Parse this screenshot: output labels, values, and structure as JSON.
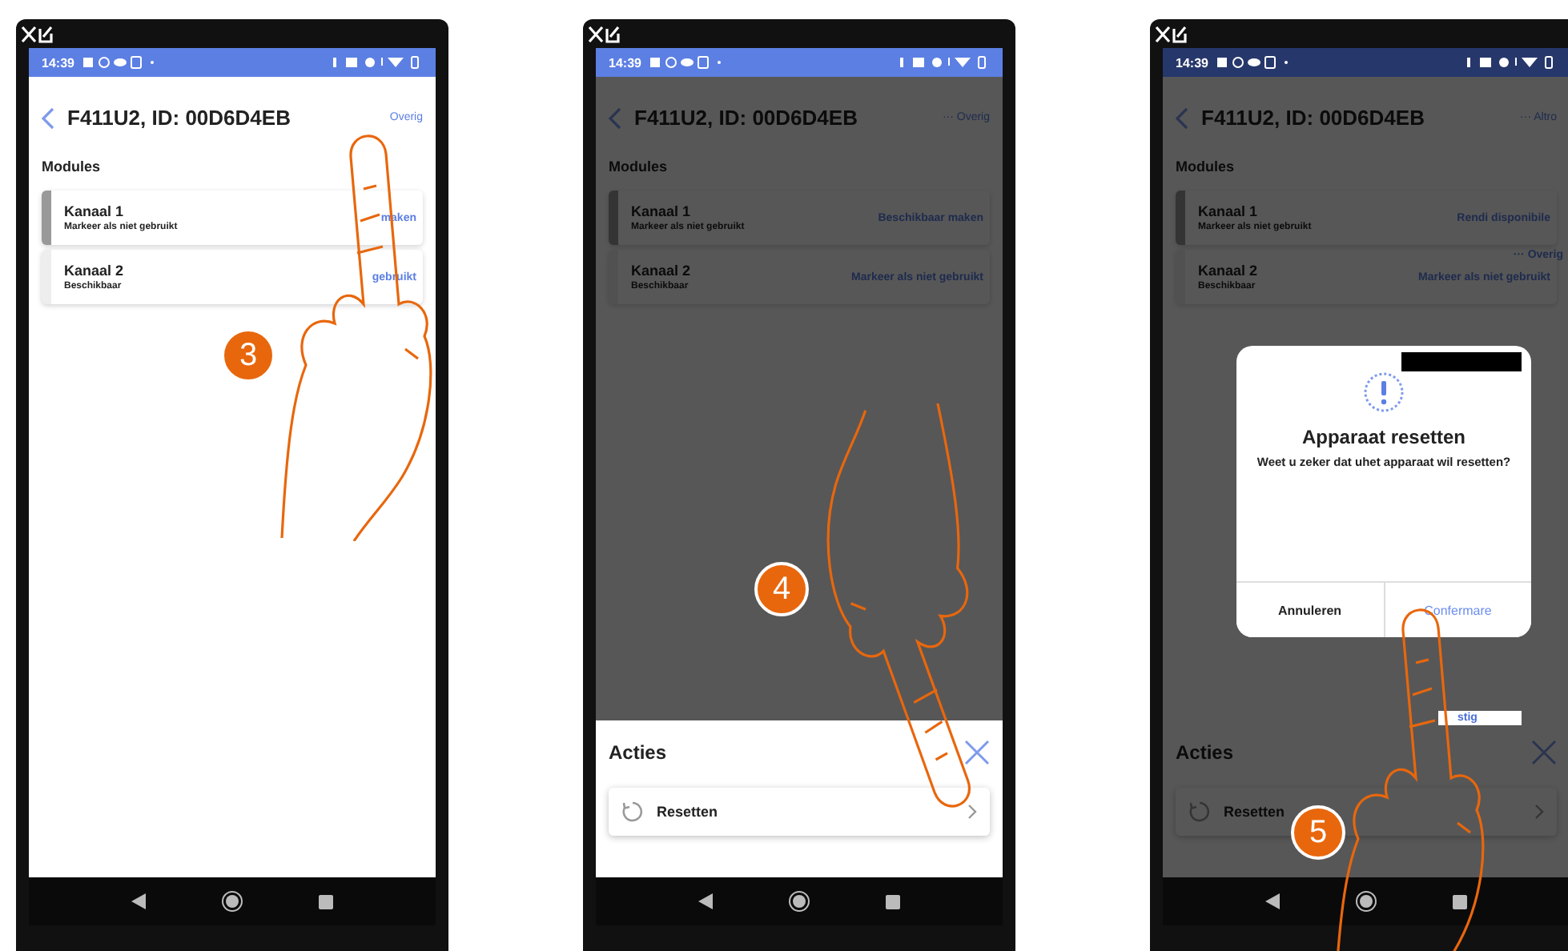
{
  "phones": [
    {
      "step": "3",
      "dimmed": false,
      "time": "14:39",
      "title": "F411U2, ID: 00D6D4EB",
      "header_action": "Overig",
      "section": "Modules",
      "cards": [
        {
          "title": "Kanaal 1",
          "subtitle": "Markeer als niet gebruikt",
          "action": "maken",
          "selected": true
        },
        {
          "title": "Kanaal 2",
          "subtitle": "Beschikbaar",
          "action": "gebruikt",
          "selected": false
        }
      ],
      "hand_pointing_down": false
    },
    {
      "step": "4",
      "dimmed": true,
      "time": "14:39",
      "title": "F411U2, ID: 00D6D4EB",
      "header_action": "··· Overig",
      "section": "Modules",
      "cards": [
        {
          "title": "Kanaal 1",
          "subtitle": "Markeer als niet gebruikt",
          "action": "Beschikbaar maken",
          "selected": true
        },
        {
          "title": "Kanaal 2",
          "subtitle": "Beschikbaar",
          "action": "Markeer als niet gebruikt",
          "selected": false
        }
      ],
      "hand_pointing_down": true,
      "sheet": {
        "title": "Acties",
        "item": "Resetten"
      }
    },
    {
      "step": "5",
      "dimmed": true,
      "time": "14:39",
      "title": "F411U2, ID: 00D6D4EB",
      "header_action": "··· Altro",
      "section": "Modules",
      "cards": [
        {
          "title": "Kanaal 1",
          "subtitle": "Markeer als niet gebruikt",
          "action": "Rendi disponibile",
          "selected": true
        },
        {
          "title": "Kanaal 2",
          "subtitle": "Beschikbaar",
          "action": "Markeer als niet gebruikt",
          "selected": false
        }
      ],
      "hand_pointing_down": false,
      "ghost_label": "··· Overig",
      "patch_label": "stig",
      "sheet": {
        "title": "Acties",
        "item": "Resetten"
      },
      "dialog": {
        "title": "Apparaat resetten",
        "message": "Weet u zeker dat uhet apparaat wil resetten?",
        "cancel": "Annuleren",
        "confirm": "Confermare"
      }
    }
  ]
}
